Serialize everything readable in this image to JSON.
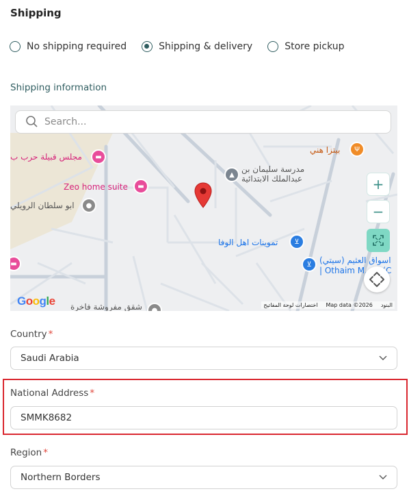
{
  "shipping": {
    "title": "Shipping",
    "options": [
      {
        "label": "No shipping required",
        "selected": false
      },
      {
        "label": "Shipping & delivery",
        "selected": true
      },
      {
        "label": "Store pickup",
        "selected": false
      }
    ]
  },
  "shipping_info": {
    "title": "Shipping information"
  },
  "map": {
    "search_placeholder": "Search...",
    "pois": {
      "majlis": "مجلس قبيلة حرب ب",
      "zeo": "Zeo home suite",
      "abu_sultan": "ابو سلطان الرويلي",
      "school_line1": "مدرسة سليمان بن",
      "school_line2": "عبدالملك الابتدائية",
      "pizza": "بيتزا هني",
      "tamween": "تموينات اهل الوفا",
      "othaim_line1": "اسواق العثيم (سيتي)",
      "othaim_line2": "| Othaim M...ts (C",
      "shuqaq": "شقق مفروشة فاخرة"
    },
    "attribution": {
      "terms": "البنود",
      "map_data": "Map data ©2026",
      "shortcuts": "اختصارات لوحة المفاتيح"
    },
    "logo_text": "Google",
    "zoom_in": "+",
    "zoom_out": "−",
    "colors": {
      "accent": "#2f5d60",
      "fullscreen_bg": "#7fd8c4",
      "marker": "#e53935"
    }
  },
  "country": {
    "label": "Country",
    "required_mark": "*",
    "value": "Saudi Arabia"
  },
  "national_address": {
    "label": "National Address",
    "required_mark": "*",
    "value": "SMMK8682",
    "highlight_color": "#d9262e"
  },
  "region": {
    "label": "Region",
    "required_mark": "*",
    "value": "Northern Borders"
  }
}
